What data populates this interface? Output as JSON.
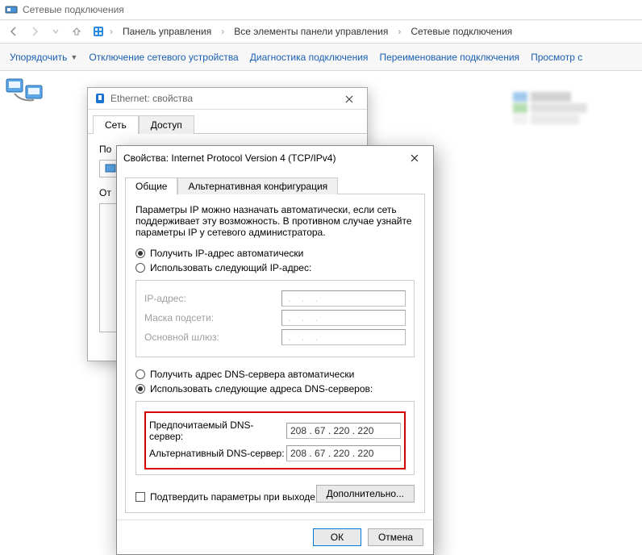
{
  "explorer": {
    "title": "Сетевые подключения",
    "breadcrumb": [
      "Панель управления",
      "Все элементы панели управления",
      "Сетевые подключения"
    ],
    "commands": {
      "organize": "Упорядочить",
      "disable": "Отключение сетевого устройства",
      "diagnose": "Диагностика подключения",
      "rename": "Переименование подключения",
      "view": "Просмотр с"
    }
  },
  "dlg1": {
    "title": "Ethernet: свойства",
    "tabs": {
      "network": "Сеть",
      "access": "Доступ"
    },
    "connect_label": "По",
    "checked_label": "От"
  },
  "dlg2": {
    "title": "Свойства: Internet Protocol Version 4 (TCP/IPv4)",
    "tabs": {
      "general": "Общие",
      "alt": "Альтернативная конфигурация"
    },
    "desc": "Параметры IP можно назначать автоматически, если сеть поддерживает эту возможность. В противном случае узнайте параметры IP у сетевого администратора.",
    "ip_auto": "Получить IP-адрес автоматически",
    "ip_manual": "Использовать следующий IP-адрес:",
    "ip_addr": "IP-адрес:",
    "mask": "Маска подсети:",
    "gateway": "Основной шлюз:",
    "dns_auto": "Получить адрес DNS-сервера автоматически",
    "dns_manual": "Использовать следующие адреса DNS-серверов:",
    "dns_pref_label": "Предпочитаемый DNS-сервер:",
    "dns_alt_label": "Альтернативный DNS-сервер:",
    "dns_pref_value": "208 . 67 . 220 . 220",
    "dns_alt_value": "208 . 67 . 220 . 220",
    "validate": "Подтвердить параметры при выходе",
    "advanced": "Дополнительно...",
    "ok": "ОК",
    "cancel": "Отмена"
  }
}
